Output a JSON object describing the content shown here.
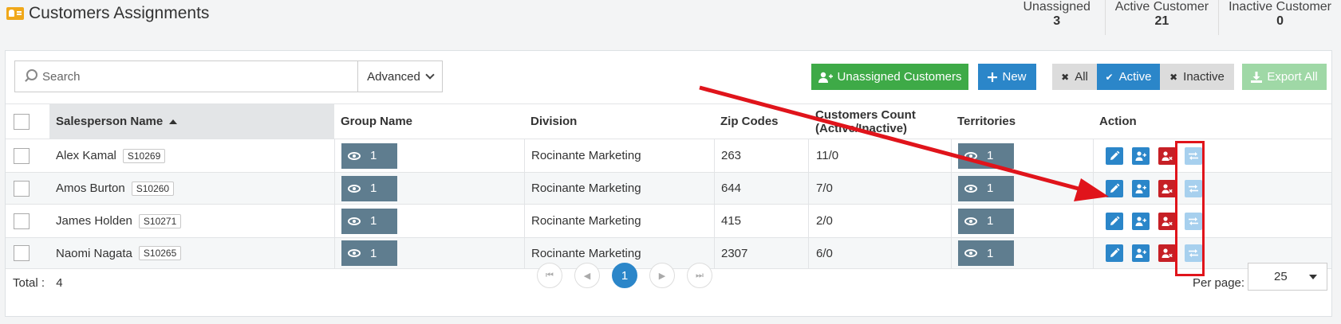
{
  "header": {
    "title": "Customers Assignments",
    "stats": [
      {
        "label": "Unassigned",
        "value": "3"
      },
      {
        "label": "Active Customer",
        "value": "21"
      },
      {
        "label": "Inactive Customer",
        "value": "0"
      }
    ]
  },
  "toolbar": {
    "search_placeholder": "Search",
    "advanced_label": "Advanced",
    "unassigned_label": "Unassigned Customers",
    "new_label": "New",
    "filter_all": "All",
    "filter_active": "Active",
    "filter_inactive": "Inactive",
    "export_label": "Export All"
  },
  "table": {
    "headers": {
      "salesperson": "Salesperson Name",
      "group": "Group Name",
      "division": "Division",
      "zip": "Zip Codes",
      "count_line1": "Customers Count",
      "count_line2": "(Active/Inactive)",
      "territories": "Territories",
      "action": "Action"
    },
    "rows": [
      {
        "name": "Alex Kamal",
        "code": "S10269",
        "group": "1",
        "division": "Rocinante Marketing",
        "zip": "263",
        "count": "11/0",
        "territories": "1"
      },
      {
        "name": "Amos Burton",
        "code": "S10260",
        "group": "1",
        "division": "Rocinante Marketing",
        "zip": "644",
        "count": "7/0",
        "territories": "1"
      },
      {
        "name": "James Holden",
        "code": "S10271",
        "group": "1",
        "division": "Rocinante Marketing",
        "zip": "415",
        "count": "2/0",
        "territories": "1"
      },
      {
        "name": "Naomi Nagata",
        "code": "S10265",
        "group": "1",
        "division": "Rocinante Marketing",
        "zip": "2307",
        "count": "6/0",
        "territories": "1"
      }
    ]
  },
  "footer": {
    "total_label": "Total :",
    "total_value": "4",
    "current_page": "1",
    "per_page_label": "Per page:",
    "per_page_value": "25"
  },
  "colors": {
    "primary": "#2b86c9",
    "success": "#3eaa47",
    "danger": "#c62026",
    "annotation": "#e0141b"
  }
}
